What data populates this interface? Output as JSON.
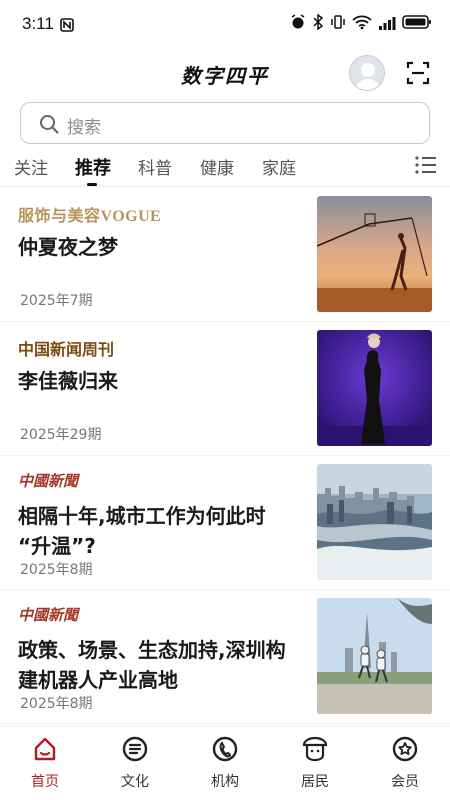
{
  "status_bar": {
    "time": "3:11"
  },
  "header": {
    "title": "数字四平"
  },
  "search": {
    "placeholder": "搜索"
  },
  "tabs": [
    {
      "label": "关注"
    },
    {
      "label": "推荐",
      "active": true
    },
    {
      "label": "科普"
    },
    {
      "label": "健康"
    },
    {
      "label": "家庭"
    }
  ],
  "articles": [
    {
      "publication": "服饰与美容VOGUE",
      "title_lines": [
        "仲夏夜之梦"
      ],
      "issue": "2025年7期",
      "thumbnail": "desert-rope-dancer-photo"
    },
    {
      "publication": "中国新闻周刊",
      "title_lines": [
        "李佳薇归来"
      ],
      "issue": "2025年29期",
      "thumbnail": "stage-singer-photo"
    },
    {
      "publication": "中國新聞",
      "title_lines": [
        "相隔十年,城市工作为何此时",
        "“升温”?"
      ],
      "issue": "2025年8期",
      "thumbnail": "city-skyline-photo"
    },
    {
      "publication": "中國新聞",
      "title_lines": [
        "政策、场景、生态加持,深圳构",
        "建机器人产业高地"
      ],
      "issue": "2025年8期",
      "thumbnail": "robots-city-photo"
    }
  ],
  "bottom_nav": [
    {
      "label": "首页",
      "icon": "home-icon",
      "active": true
    },
    {
      "label": "文化",
      "icon": "culture-icon"
    },
    {
      "label": "机构",
      "icon": "institution-icon"
    },
    {
      "label": "居民",
      "icon": "resident-icon"
    },
    {
      "label": "会员",
      "icon": "member-icon"
    }
  ],
  "colors": {
    "accent": "#b31d1d",
    "fashion_logo": "#b8945e",
    "news_logo": "#7a4d12",
    "china_logo": "#a43a2c"
  }
}
